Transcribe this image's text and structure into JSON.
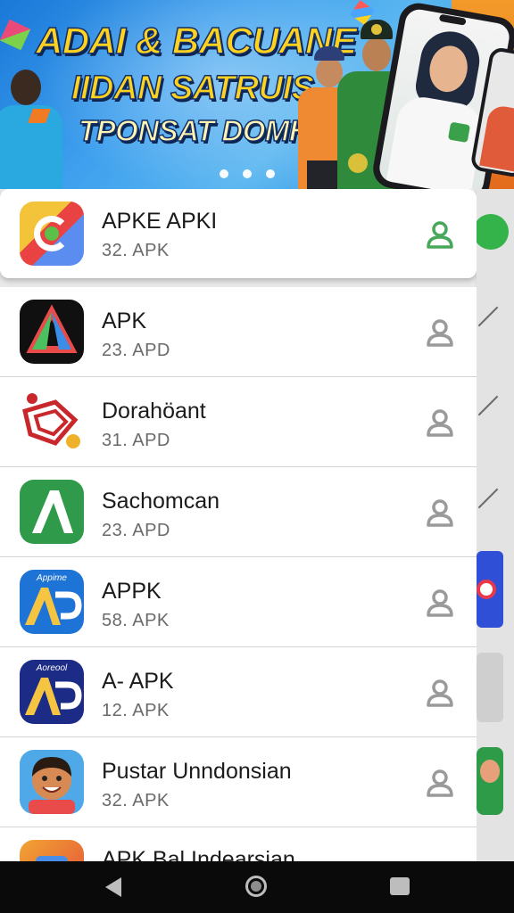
{
  "banner": {
    "headline_1": "ADAI & BACUANE",
    "headline_2": "IIDAN SATRUIS",
    "headline_3": "TPONSAT DOMH!!",
    "carousel_dots": 3
  },
  "apps": [
    {
      "title": "APKE APKI",
      "subtitle": "32. APK",
      "icon": "swirl-app-icon",
      "selected": true
    },
    {
      "title": "APK",
      "subtitle": "23. APD",
      "icon": "triangle-app-icon",
      "selected": false
    },
    {
      "title": "Dorahöant",
      "subtitle": "31. APD",
      "icon": "red-maze-app-icon",
      "selected": false
    },
    {
      "title": "Sachomcan",
      "subtitle": "23. APD",
      "icon": "green-arch-app-icon",
      "selected": false
    },
    {
      "title": "APPK",
      "subtitle": "58. APK",
      "icon": "blue-ap-app-icon",
      "icon_caption": "Appime",
      "selected": false
    },
    {
      "title": "A- APK",
      "subtitle": "12. APK",
      "icon": "navy-ap-app-icon",
      "icon_caption": "Aoreool",
      "selected": false
    },
    {
      "title": "Pustar Unndonsian",
      "subtitle": "32. APK",
      "icon": "cartoon-face-app-icon",
      "selected": false
    },
    {
      "title": "APK Bal Indearsian",
      "subtitle": "",
      "icon": "orange-app-icon",
      "selected": false
    }
  ],
  "colors": {
    "selected_user_icon": "#48a85a",
    "user_icon": "#9a9a9a",
    "nav_bar": "#0a0a0a"
  },
  "navbar": {
    "back": "back-icon",
    "home": "home-icon",
    "recents": "recents-icon"
  }
}
